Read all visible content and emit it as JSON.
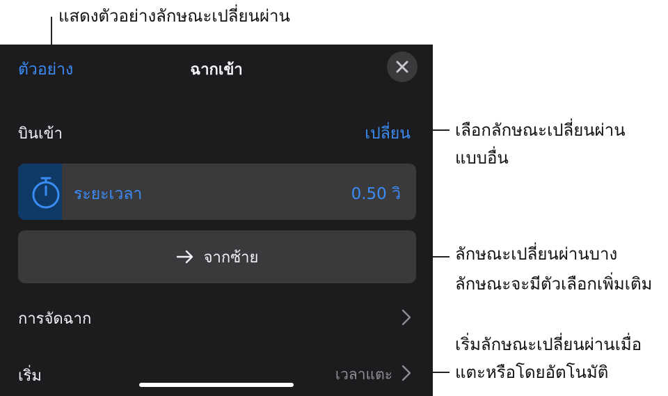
{
  "callouts": {
    "preview": "แสดงตัวอย่างลักษณะเปลี่ยนผ่าน",
    "change_line1": "เลือกลักษณะเปลี่ยนผ่าน",
    "change_line2": "แบบอื่น",
    "direction_line1": "ลักษณะเปลี่ยนผ่านบาง",
    "direction_line2": "ลักษณะจะมีตัวเลือกเพิ่มเติม",
    "start_line1": "เริ่มลักษณะเปลี่ยนผ่านเมื่อ",
    "start_line2": "แตะหรือโดยอัตโนมัติ"
  },
  "header": {
    "preview_label": "ตัวอย่าง",
    "title": "ฉากเข้า",
    "close_icon": "close-icon"
  },
  "transition": {
    "name": "บินเข้า",
    "change_label": "เปลี่ยน"
  },
  "duration": {
    "label": "ระยะเวลา",
    "value": "0.50 วิ",
    "icon": "stopwatch-icon",
    "fill_fraction": 0.11
  },
  "direction": {
    "icon": "arrow-right-icon",
    "label": "จากซ้าย"
  },
  "rows": {
    "delivery_label": "การจัดฉาก",
    "start_label": "เริ่ม",
    "start_value": "เวลาแตะ"
  },
  "colors": {
    "accent": "#3b8bf5",
    "panel": "#1c1c1e",
    "control": "#3a3a3c"
  }
}
